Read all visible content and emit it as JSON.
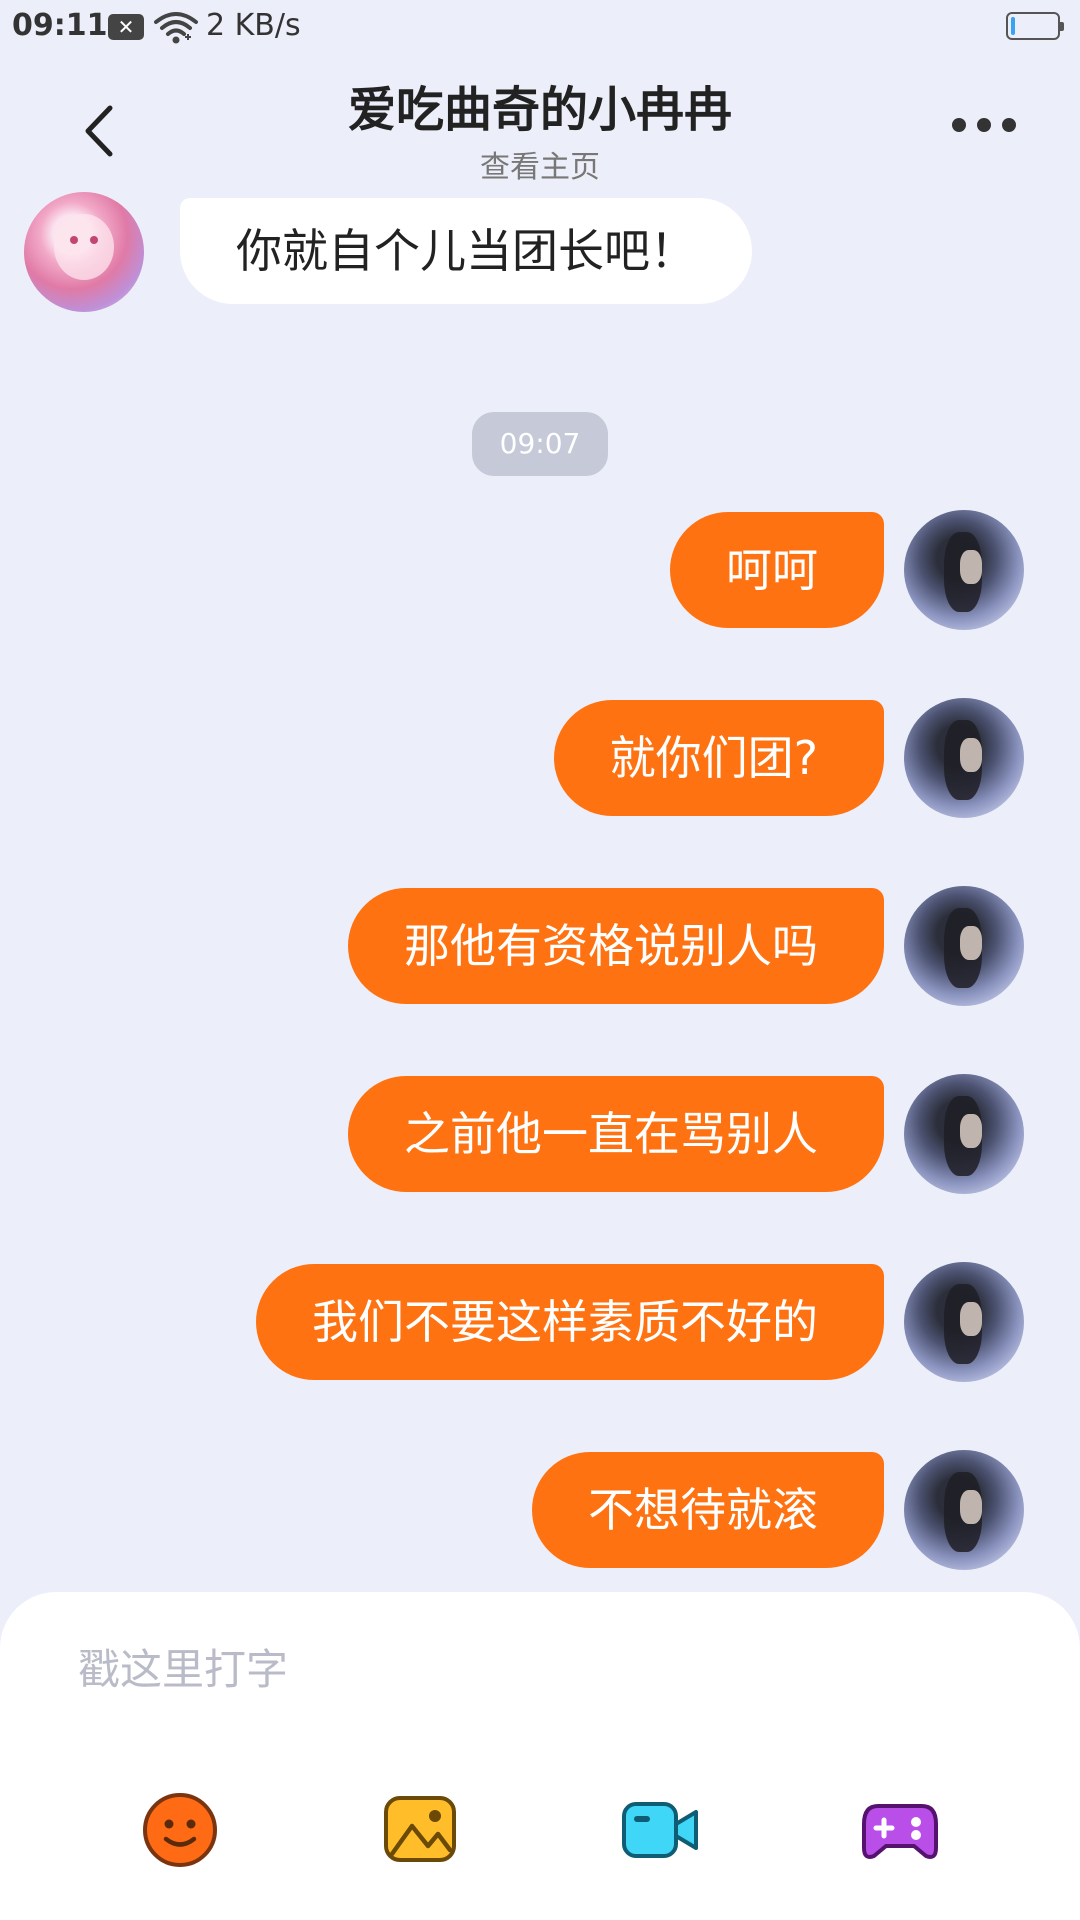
{
  "status_bar": {
    "time": "09:11",
    "notification_icon": "close-box-icon",
    "wifi_icon": "wifi-icon",
    "network_speed": "2 KB/s",
    "battery_icon": "battery-icon",
    "battery_level": 0.08,
    "battery_color": "#38a3f1"
  },
  "header": {
    "title": "爱吃曲奇的小冉冉",
    "subtitle": "查看主页",
    "back_icon": "chevron-left-icon",
    "more_icon": "more-dots-icon"
  },
  "messages": {
    "incoming": {
      "text": "你就自个儿当团长吧！"
    },
    "timestamp": "09:07",
    "outgoing": [
      {
        "text": "呵呵"
      },
      {
        "text": "就你们团?"
      },
      {
        "text": "那他有资格说别人吗"
      },
      {
        "text": "之前他一直在骂别人"
      },
      {
        "text": "我们不要这样素质不好的"
      },
      {
        "text": "不想待就滚"
      }
    ]
  },
  "input": {
    "placeholder": "戳这里打字"
  },
  "toolbar": {
    "emoji_icon": "emoji-icon",
    "image_icon": "image-icon",
    "video_icon": "video-camera-icon",
    "game_icon": "gamepad-icon"
  },
  "colors": {
    "background": "#eceff9",
    "outgoing_bubble": "#ff7212",
    "incoming_bubble": "#ffffff",
    "emoji_icon": "#ff6a14",
    "image_icon": "#ffbd29",
    "video_icon": "#3fd6f7",
    "game_icon": "#b94fe8"
  }
}
